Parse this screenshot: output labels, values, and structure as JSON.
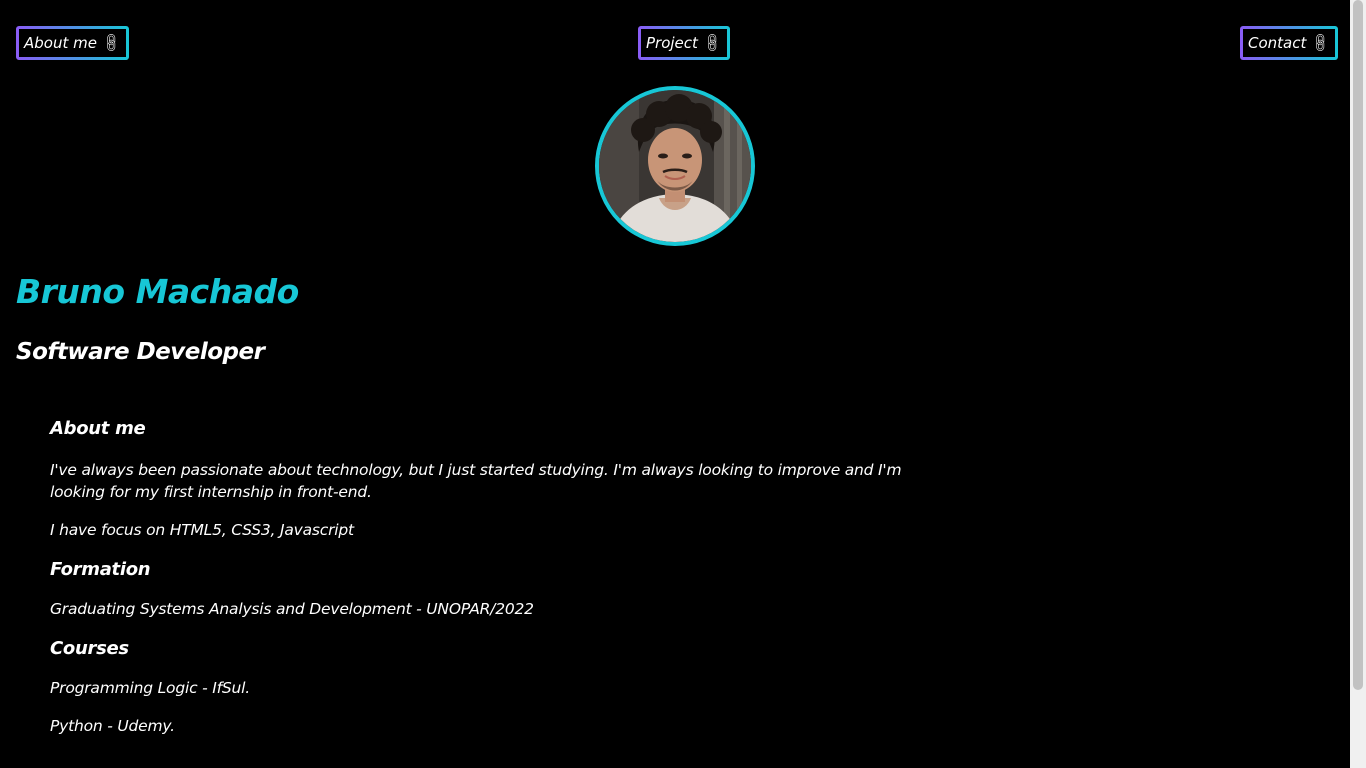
{
  "nav": {
    "about_label": "About me",
    "project_label": "Project",
    "contact_label": "Contact",
    "link_icon": "link-icon"
  },
  "profile": {
    "photo": "profile-photo",
    "name": "Bruno Machado",
    "role": "Software Developer"
  },
  "about": {
    "title": "About me",
    "paragraph1": "I've always been passionate about technology, but I just started studying. I'm always looking to improve and I'm looking for my first internship in front-end.",
    "paragraph2": "I have focus on HTML5, CSS3, Javascript"
  },
  "formation": {
    "title": "Formation",
    "item": "Graduating Systems Analysis and Development - UNOPAR/2022"
  },
  "courses": {
    "title": "Courses",
    "items": [
      "Programming Logic - IfSul.",
      "Python - Udemy."
    ]
  },
  "colors": {
    "background": "#000000",
    "accent": "#17c7d6",
    "gradient_start": "#8b5cf6",
    "text": "#ffffff"
  }
}
